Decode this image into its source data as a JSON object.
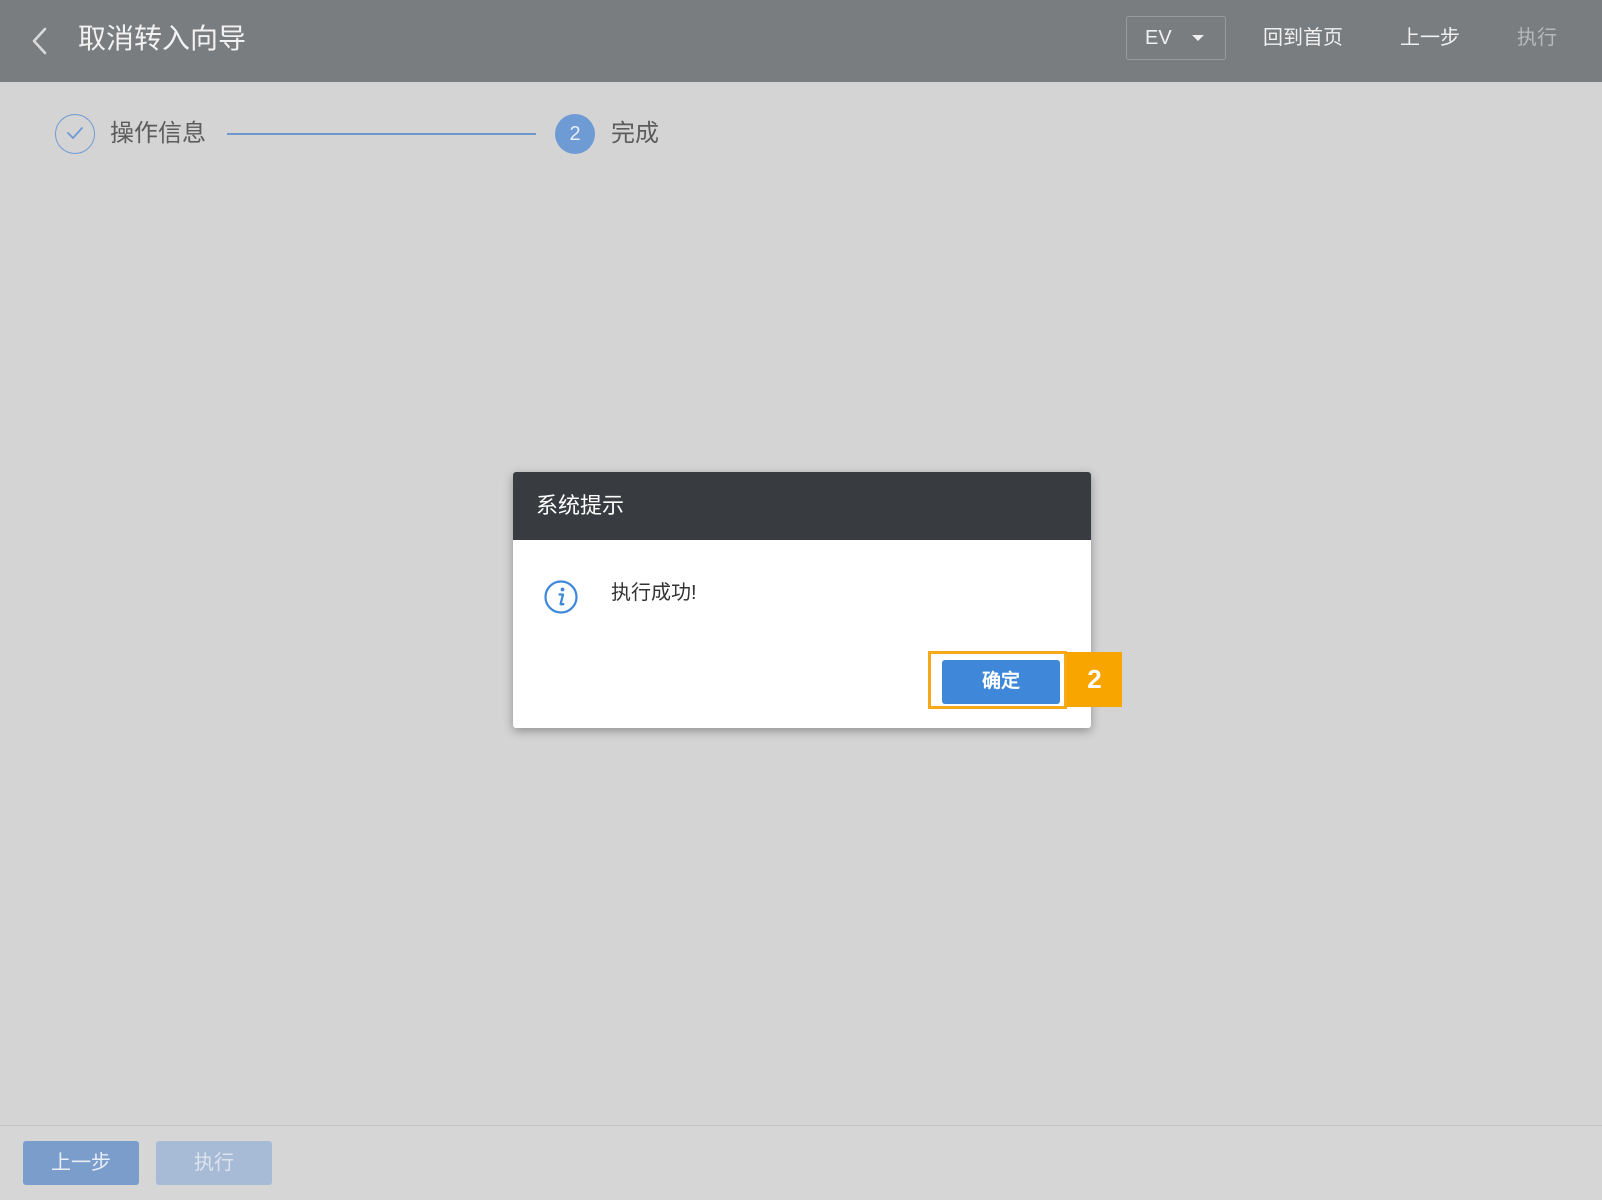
{
  "header": {
    "title": "取消转入向导",
    "env_selected": "EV",
    "home_label": "回到首页",
    "prev_label": "上一步",
    "execute_label": "执行",
    "back_icon": "chevron-left-icon",
    "env_caret_icon": "caret-down-icon"
  },
  "steps": [
    {
      "icon": "check-icon",
      "label": "操作信息"
    },
    {
      "number": "2",
      "label": "完成"
    }
  ],
  "dialog": {
    "title": "系统提示",
    "icon": "info-icon",
    "message": "执行成功!",
    "ok_label": "确定"
  },
  "callout": {
    "number": "2"
  },
  "footer": {
    "prev_label": "上一步",
    "execute_label": "执行"
  },
  "colors": {
    "accent": "#3e87d9",
    "step": "#6f9bd5",
    "callout": "#f9a500",
    "dialog_header": "#383c40"
  }
}
